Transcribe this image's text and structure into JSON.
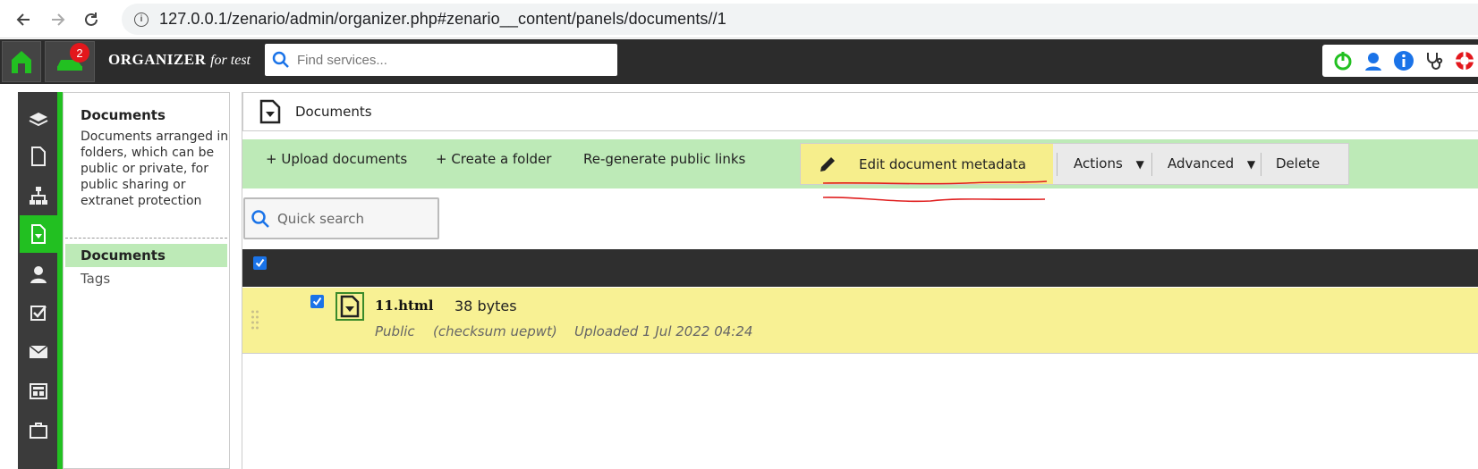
{
  "browser": {
    "url": "127.0.0.1/zenario/admin/organizer.php#zenario__content/panels/documents//1"
  },
  "topbar": {
    "brand": "ORGANIZER",
    "brand_suffix": "for test",
    "notification_count": "2",
    "search_placeholder": "Find services...",
    "colors": {
      "accent": "#22c021",
      "badge": "#e3171c",
      "bar": "#2c2c2c"
    }
  },
  "sidebar": {
    "title": "Documents",
    "description": "Documents arranged in folders, which can be public or private, for public sharing or extranet protection",
    "items": [
      {
        "label": "Documents",
        "active": true
      },
      {
        "label": "Tags",
        "active": false
      }
    ]
  },
  "panel": {
    "title": "Documents"
  },
  "toolbar": {
    "upload": "+ Upload documents",
    "create_folder": "+ Create a folder",
    "regenerate": "Re-generate public links",
    "edit_metadata": "Edit document metadata",
    "actions": "Actions",
    "advanced": "Advanced",
    "delete": "Delete"
  },
  "quick_search": {
    "placeholder": "Quick search"
  },
  "rows": [
    {
      "name": "11.html",
      "size": "38 bytes",
      "privacy": "Public",
      "checksum": "(checksum uepwt)",
      "uploaded": "Uploaded 1 Jul 2022 04:24",
      "checked": true
    }
  ]
}
